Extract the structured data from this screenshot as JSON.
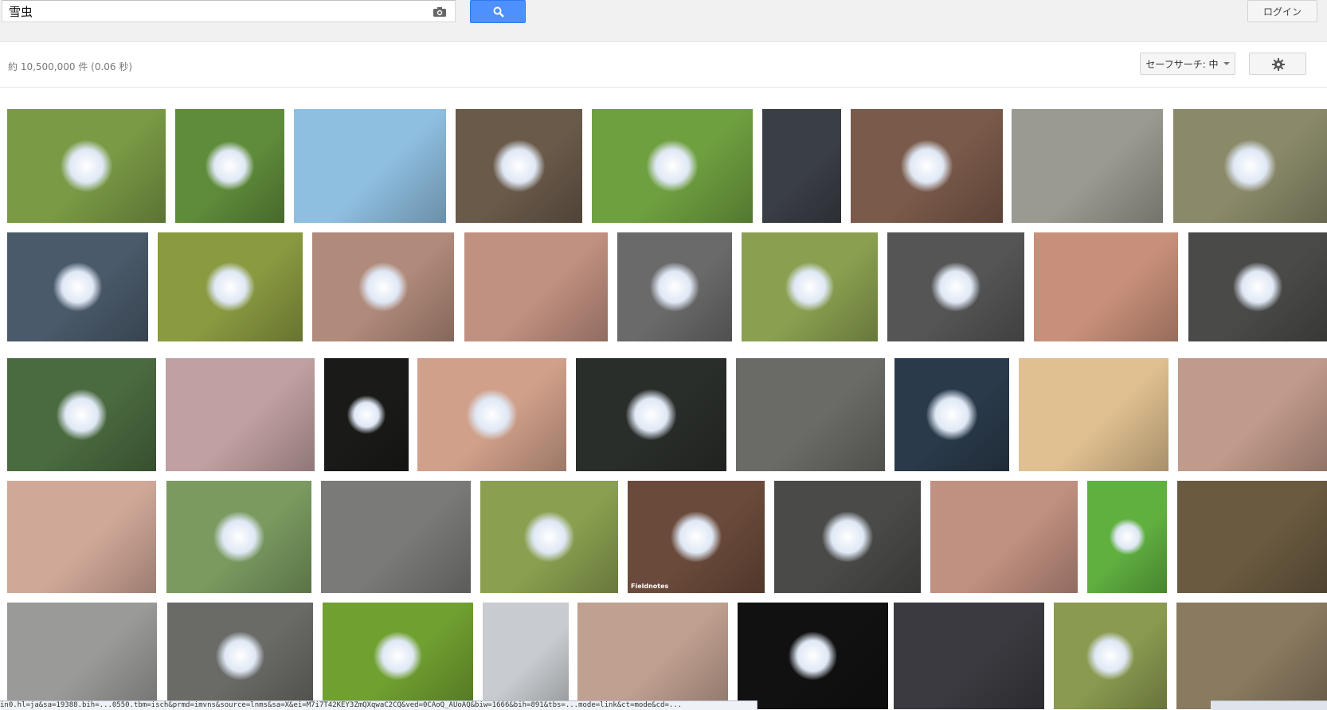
{
  "search": {
    "query": "雪虫",
    "camera_icon": "camera-icon",
    "button_icon": "magnifier-icon"
  },
  "header": {
    "login_label": "ログイン"
  },
  "results": {
    "stats": "約 10,500,000 件 (0.06 秒)",
    "safesearch_label": "セーフサーチ: 中",
    "settings_icon": "gear-icon"
  },
  "images": [
    {
      "row": 1,
      "bg": "#7a9a45",
      "bug": true
    },
    {
      "row": 1,
      "bg": "#5f8c3a",
      "bug": true
    },
    {
      "row": 1,
      "bg": "#8fbfe0",
      "bug": false
    },
    {
      "row": 1,
      "bg": "#6a5a4a",
      "bug": true
    },
    {
      "row": 1,
      "bg": "#6fa040",
      "bug": true
    },
    {
      "row": 1,
      "bg": "#3a3e45",
      "bug": false
    },
    {
      "row": 1,
      "bg": "#7a5a4a",
      "bug": true
    },
    {
      "row": 1,
      "bg": "#9a9a90",
      "bug": false
    },
    {
      "row": 1,
      "bg": "#8a8a6a",
      "bug": true
    },
    {
      "row": 2,
      "bg": "#4a5a6a",
      "bug": true
    },
    {
      "row": 2,
      "bg": "#8a9a40",
      "bug": true
    },
    {
      "row": 2,
      "bg": "#b08a7a",
      "bug": true
    },
    {
      "row": 2,
      "bg": "#c09080",
      "bug": false
    },
    {
      "row": 2,
      "bg": "#6a6a6a",
      "bug": true
    },
    {
      "row": 2,
      "bg": "#8aa050",
      "bug": true
    },
    {
      "row": 2,
      "bg": "#555555",
      "bug": true
    },
    {
      "row": 2,
      "bg": "#c8907a",
      "bug": false
    },
    {
      "row": 2,
      "bg": "#4a4a48",
      "bug": true
    },
    {
      "row": 3,
      "bg": "#4a6a40",
      "bug": true
    },
    {
      "row": 3,
      "bg": "#c0a0a0",
      "bug": false
    },
    {
      "row": 3,
      "bg": "#1a1a18",
      "bug": true
    },
    {
      "row": 3,
      "bg": "#d0a08a",
      "bug": true
    },
    {
      "row": 3,
      "bg": "#2a2e2a",
      "bug": true
    },
    {
      "row": 3,
      "bg": "#6a6a66",
      "bug": false
    },
    {
      "row": 3,
      "bg": "#2a3a4a",
      "bug": true
    },
    {
      "row": 3,
      "bg": "#e0c090",
      "bug": false
    },
    {
      "row": 3,
      "bg": "#c09a8a",
      "bug": false
    },
    {
      "row": 4,
      "bg": "#d0a898",
      "bug": false
    },
    {
      "row": 4,
      "bg": "#7a9a60",
      "bug": true
    },
    {
      "row": 4,
      "bg": "#7a7a78",
      "bug": false
    },
    {
      "row": 4,
      "bg": "#8aa050",
      "bug": true
    },
    {
      "row": 4,
      "bg": "#6a4a3a",
      "bug": true
    },
    {
      "row": 4,
      "bg": "#4a4a48",
      "bug": true
    },
    {
      "row": 4,
      "bg": "#c09080",
      "bug": false
    },
    {
      "row": 4,
      "bg": "#60b040",
      "bug": true
    },
    {
      "row": 4,
      "bg": "#6a5a40",
      "bug": false
    },
    {
      "row": 5,
      "bg": "#9a9a98",
      "bug": false
    },
    {
      "row": 5,
      "bg": "#6a6a66",
      "bug": true
    },
    {
      "row": 5,
      "bg": "#70a030",
      "bug": true
    },
    {
      "row": 5,
      "bg": "#c8ccd0",
      "bug": false
    },
    {
      "row": 5,
      "bg": "#c0a090",
      "bug": false
    },
    {
      "row": 5,
      "bg": "#111111",
      "bug": true
    },
    {
      "row": 5,
      "bg": "#3a3a40",
      "bug": false
    },
    {
      "row": 5,
      "bg": "#8a9a50",
      "bug": true
    },
    {
      "row": 5,
      "bg": "#8a7a60",
      "bug": false
    }
  ],
  "overlay_labels": {
    "fieldnotes": "Fieldnotes"
  },
  "statusbar": {
    "text": "in0.hl=ja&sa=19388.bih=...0550.tbm=isch&prmd=imvns&source=lnms&sa=X&ei=M7i7T42KEY3ZmQXqwaC2CQ&ved=0CAoQ_AUoAQ&biw=1666&bih=891&tbs=...mode=link&ct=mode&cd=..."
  },
  "colors": {
    "accent": "#4d90fe",
    "topbar_bg": "#f1f1f1",
    "button_bg": "#f5f5f5"
  }
}
